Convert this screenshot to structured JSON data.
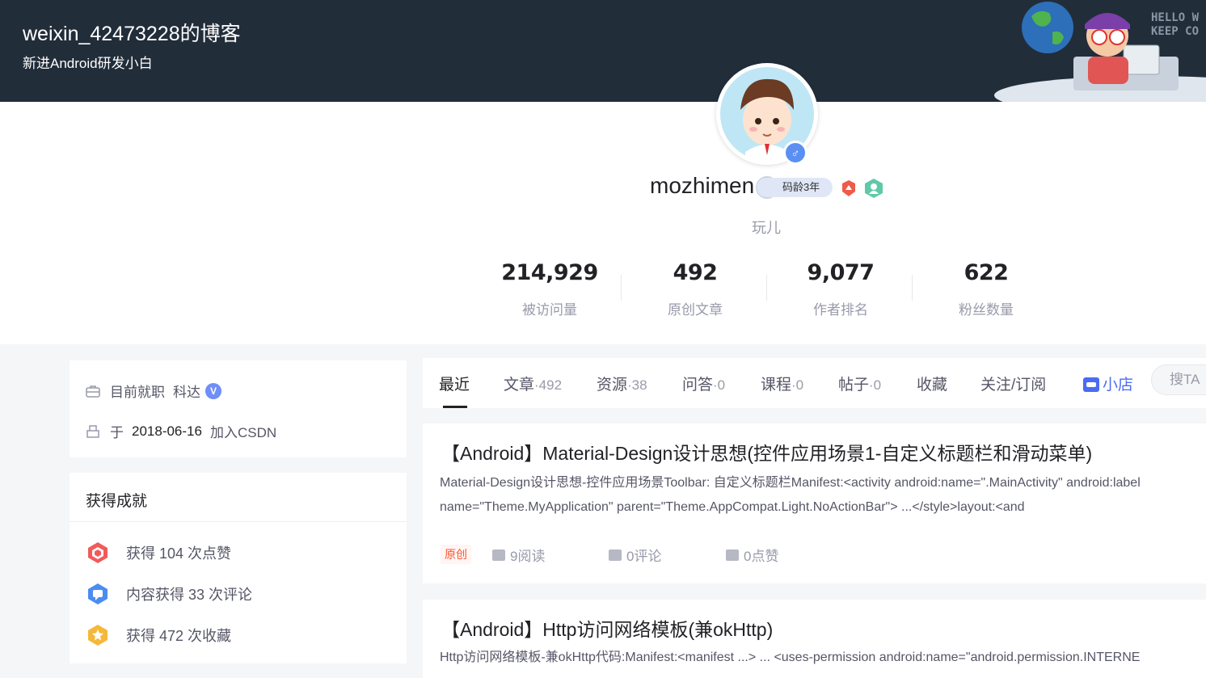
{
  "banner": {
    "title": "weixin_42473228的博客",
    "subtitle": "新进Android研发小白",
    "hello_text": "HELLO W\nKEEP CO"
  },
  "profile": {
    "username": "mozhimen",
    "code_age": "码龄3年",
    "tag": "玩儿",
    "stats": [
      {
        "value": "214,929",
        "label": "被访问量"
      },
      {
        "value": "492",
        "label": "原创文章"
      },
      {
        "value": "9,077",
        "label": "作者排名"
      },
      {
        "value": "622",
        "label": "粉丝数量"
      }
    ]
  },
  "sidebar": {
    "employment_label": "目前就职",
    "employment_company": "科达",
    "join_prefix": "于",
    "join_date": "2018-06-16",
    "join_suffix": "加入CSDN",
    "achievements_title": "获得成就",
    "achievements": [
      {
        "text": "获得 104 次点赞",
        "icon": "like-achievement-icon",
        "color": "#f25a5a"
      },
      {
        "text": "内容获得 33 次评论",
        "icon": "comment-achievement-icon",
        "color": "#4b8cf0"
      },
      {
        "text": "获得 472 次收藏",
        "icon": "favorite-achievement-icon",
        "color": "#f5b83a"
      }
    ]
  },
  "tabs": [
    {
      "label": "最近",
      "count": ""
    },
    {
      "label": "文章",
      "count": "·492"
    },
    {
      "label": "资源",
      "count": "·38"
    },
    {
      "label": "问答",
      "count": "·0"
    },
    {
      "label": "课程",
      "count": "·0"
    },
    {
      "label": "帖子",
      "count": "·0"
    },
    {
      "label": "收藏",
      "count": ""
    },
    {
      "label": "关注/订阅",
      "count": ""
    },
    {
      "label": "小店",
      "count": ""
    }
  ],
  "search_placeholder": "搜TA",
  "articles": [
    {
      "title": "【Android】Material-Design设计思想(控件应用场景1-自定义标题栏和滑动菜单)",
      "desc_line1": "Material-Design设计思想-控件应用场景Toolbar: 自定义标题栏Manifest:<activity android:name=\".MainActivity\" android:label",
      "desc_line2": "name=\"Theme.MyApplication\" parent=\"Theme.AppCompat.Light.NoActionBar\"> ...</style>layout:<and",
      "tag": "原创",
      "reads": "9阅读",
      "comments": "0评论",
      "likes": "0点赞"
    },
    {
      "title": "【Android】Http访问网络模板(兼okHttp)",
      "desc_line1": "Http访问网络模板-兼okHttp代码:Manifest:<manifest ...> ... <uses-permission android:name=\"android.permission.INTERNE"
    }
  ]
}
